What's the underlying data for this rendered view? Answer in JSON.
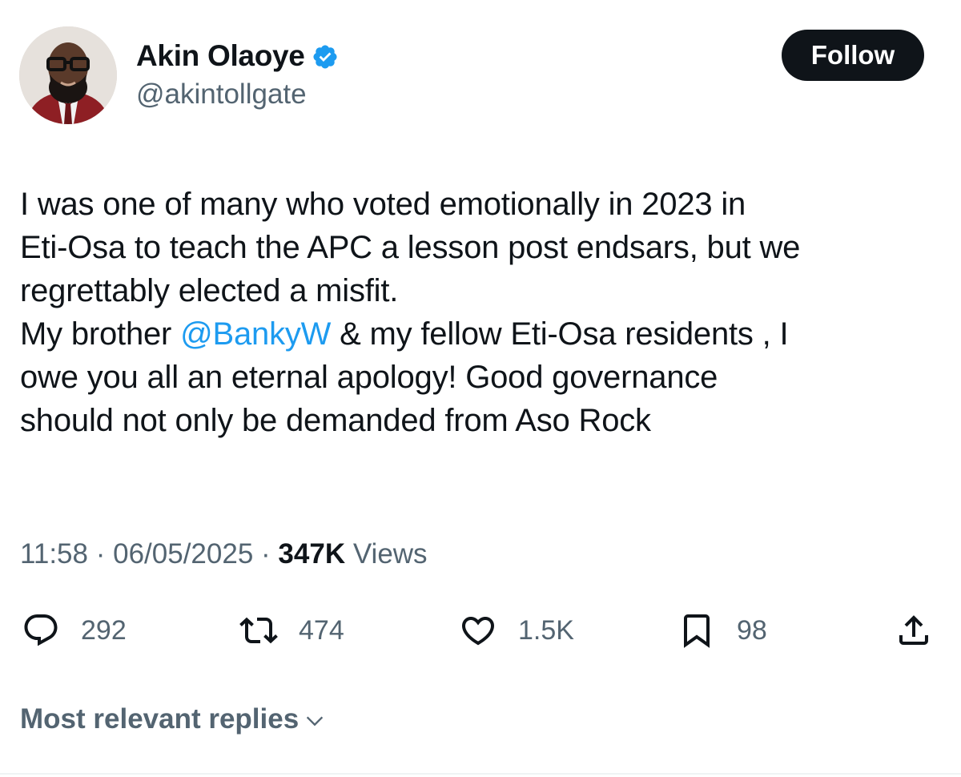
{
  "author": {
    "name": "Akin Olaoye",
    "handle": "@akintollgate",
    "verified": true,
    "avatar_icon": "profile-photo"
  },
  "follow_label": "Follow",
  "tweet": {
    "lines": [
      "I was one of many who voted emotionally in 2023 in",
      "Eti-Osa to teach the APC a lesson post endsars, but we",
      "regrettably elected a misfit."
    ],
    "mention_line_prefix": "My brother ",
    "mention": "@BankyW",
    "mention_line_suffix": " & my fellow Eti-Osa residents , I",
    "tail_lines": [
      "owe you all an eternal apology! Good governance",
      "should not only be demanded from Aso Rock"
    ]
  },
  "meta": {
    "time": "11:58",
    "separator": "·",
    "date": "06/05/2025",
    "views_count": "347K",
    "views_label": "Views"
  },
  "actions": {
    "replies": {
      "icon": "reply-icon",
      "count": "292"
    },
    "reposts": {
      "icon": "repost-icon",
      "count": "474"
    },
    "likes": {
      "icon": "heart-icon",
      "count": "1.5K"
    },
    "bookmarks": {
      "icon": "bookmark-icon",
      "count": "98"
    },
    "share": {
      "icon": "share-icon"
    }
  },
  "replies_sort_label": "Most relevant replies",
  "colors": {
    "text": "#0f1419",
    "secondary": "#536471",
    "accent": "#1d9bf0",
    "button_bg": "#0f1419"
  }
}
